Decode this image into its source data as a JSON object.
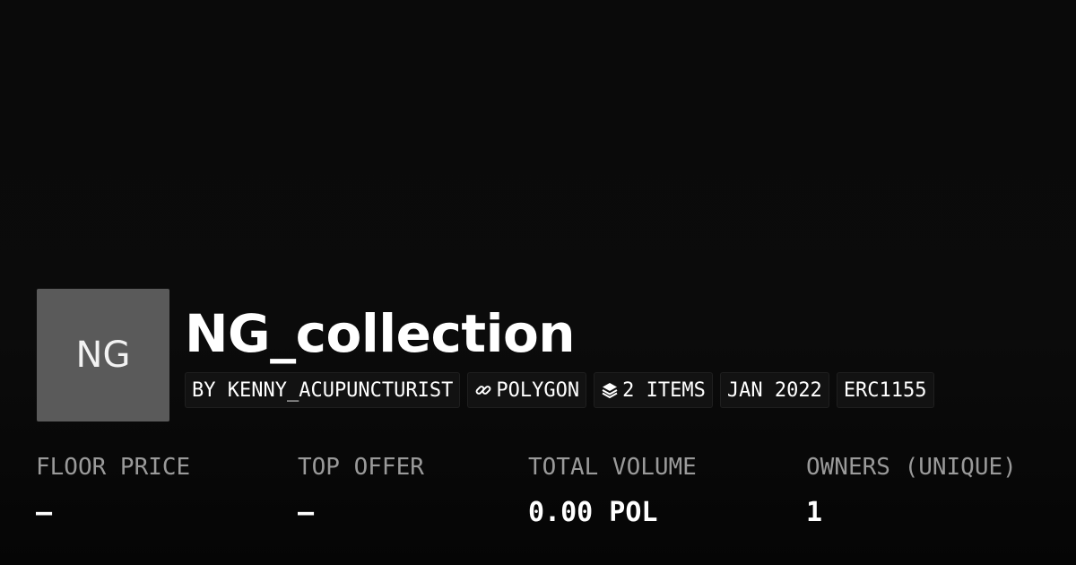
{
  "collection": {
    "avatar_text": "NG",
    "name": "NG_collection"
  },
  "tags": {
    "creator": "BY KENNY_ACUPUNCTURIST",
    "chain": "POLYGON",
    "chain_icon": "link-icon",
    "items": "2 ITEMS",
    "items_icon": "layers-icon",
    "date": "JAN 2022",
    "standard": "ERC1155"
  },
  "stats": {
    "floor_price": {
      "label": "FLOOR PRICE",
      "value": "–"
    },
    "top_offer": {
      "label": "TOP OFFER",
      "value": "–"
    },
    "total_volume": {
      "label": "TOTAL VOLUME",
      "value": "0.00 POL"
    },
    "owners": {
      "label": "OWNERS (UNIQUE)",
      "value": "1"
    }
  },
  "colors": {
    "background": "#0a0a0a",
    "avatar": "#5a5a5a",
    "tag_background": "#121212",
    "label_gray": "#9a9a9a",
    "text": "#ffffff"
  }
}
